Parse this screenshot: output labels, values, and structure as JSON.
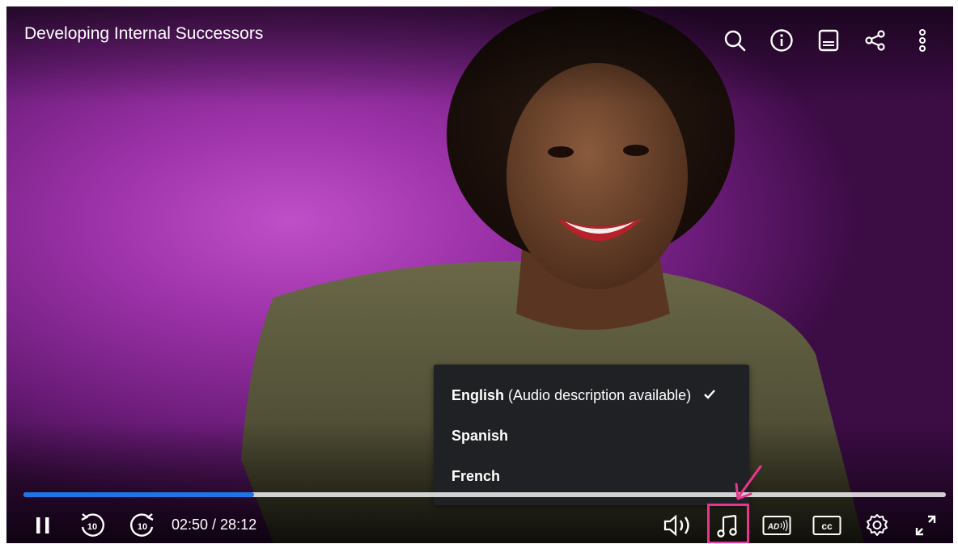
{
  "player": {
    "title": "Developing Internal Successors",
    "time_display": "02:50 / 28:12",
    "progress_fraction": 0.25
  },
  "audio_menu": {
    "items": [
      {
        "label": "English",
        "note": "(Audio description available)",
        "selected": true
      },
      {
        "label": "Spanish",
        "note": "",
        "selected": false
      },
      {
        "label": "French",
        "note": "",
        "selected": false
      }
    ]
  },
  "top_toolbar": {
    "icons": [
      "search-icon",
      "info-icon",
      "transcript-icon",
      "share-icon",
      "more-vertical-icon"
    ]
  },
  "bottom_toolbar": {
    "icons": [
      "pause-icon",
      "rewind-10-icon",
      "forward-10-icon",
      "volume-icon",
      "audio-track-icon",
      "audio-description-icon",
      "closed-captions-icon",
      "settings-icon",
      "fullscreen-icon"
    ],
    "rewind_label": "10",
    "forward_label": "10",
    "ad_label": "AD",
    "cc_label": "cc"
  },
  "colors": {
    "progress_accent": "#1d76e8",
    "highlight": "#e8358e",
    "menu_bg": "#202124"
  }
}
